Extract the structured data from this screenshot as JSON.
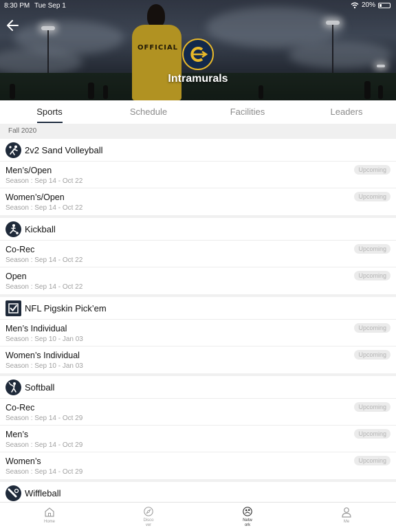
{
  "status_bar": {
    "time": "8:30 PM",
    "date": "Tue Sep 1",
    "battery": "20%"
  },
  "header": {
    "title": "Intramurals"
  },
  "tabs": [
    {
      "label": "Sports",
      "active": true
    },
    {
      "label": "Schedule",
      "active": false
    },
    {
      "label": "Facilities",
      "active": false
    },
    {
      "label": "Leaders",
      "active": false
    }
  ],
  "season_label": "Fall 2020",
  "sports": [
    {
      "name": "2v2 Sand Volleyball",
      "icon": "volleyball-player-icon",
      "divisions": [
        {
          "name": "Men’s/Open",
          "season": "Season : Sep 14 - Oct 22",
          "status": "Upcoming"
        },
        {
          "name": "Women’s/Open",
          "season": "Season : Sep 14 - Oct 22",
          "status": "Upcoming"
        }
      ]
    },
    {
      "name": "Kickball",
      "icon": "kickball-player-icon",
      "divisions": [
        {
          "name": "Co-Rec",
          "season": "Season : Sep 14 - Oct 22",
          "status": "Upcoming"
        },
        {
          "name": "Open",
          "season": "Season : Sep 14 - Oct 22",
          "status": "Upcoming"
        }
      ]
    },
    {
      "name": "NFL Pigskin Pick’em",
      "icon": "checkbox-icon",
      "divisions": [
        {
          "name": "Men’s Individual",
          "season": "Season : Sep 10 - Jan 03",
          "status": "Upcoming"
        },
        {
          "name": "Women’s Individual",
          "season": "Season : Sep 10 - Jan 03",
          "status": "Upcoming"
        }
      ]
    },
    {
      "name": "Softball",
      "icon": "softball-batter-icon",
      "divisions": [
        {
          "name": "Co-Rec",
          "season": "Season : Sep 14 - Oct 29",
          "status": "Upcoming"
        },
        {
          "name": "Men’s",
          "season": "Season : Sep 14 - Oct 29",
          "status": "Upcoming"
        },
        {
          "name": "Women’s",
          "season": "Season : Sep 14 - Oct 29",
          "status": "Upcoming"
        }
      ]
    },
    {
      "name": "Wiffleball",
      "icon": "wiffleball-bat-icon",
      "divisions": []
    }
  ],
  "bottom_nav": [
    {
      "label": "Home",
      "icon": "home-icon",
      "active": false
    },
    {
      "label": "Disco ver",
      "icon": "compass-icon",
      "active": false
    },
    {
      "label": "Netw ork",
      "icon": "network-icon",
      "active": true
    },
    {
      "label": "Me",
      "icon": "person-icon",
      "active": false
    }
  ],
  "colors": {
    "accent_navy": "#1f2d3f",
    "logo_gold": "#e9b929",
    "badge_bg": "#ebebeb"
  }
}
